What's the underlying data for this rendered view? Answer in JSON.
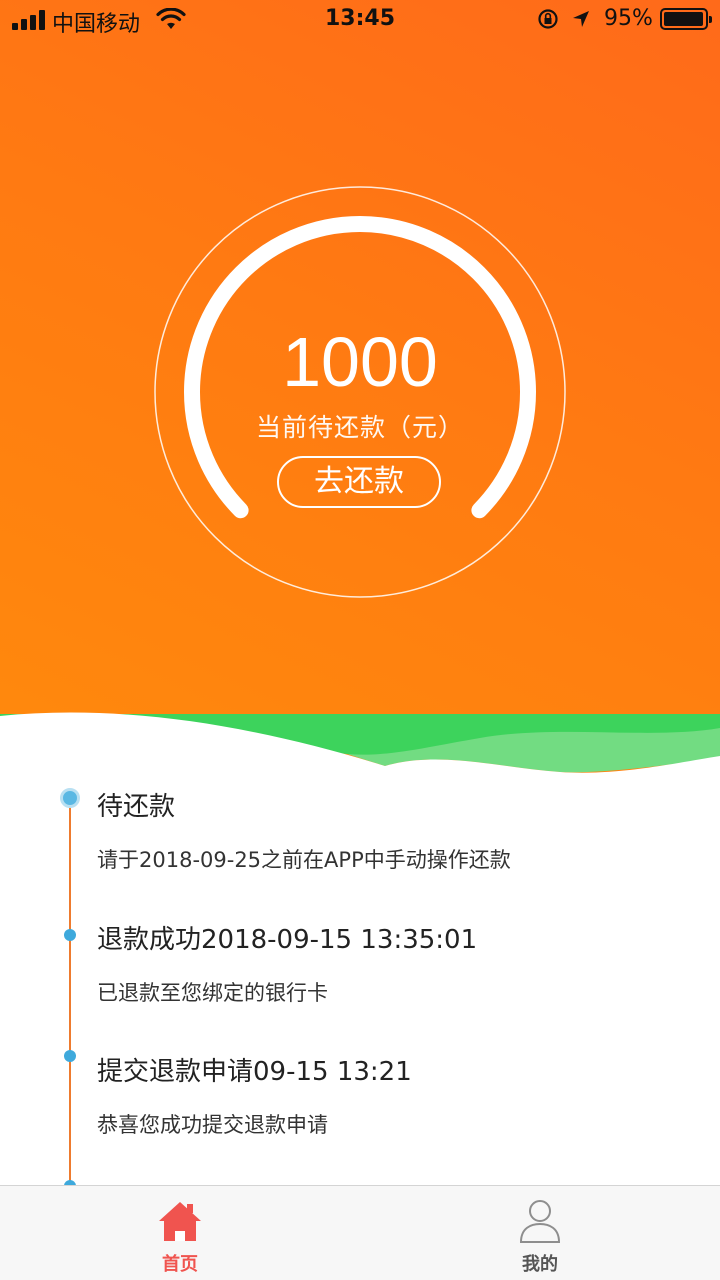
{
  "status_bar": {
    "carrier": "中国移动",
    "time": "13:45",
    "battery": "95%",
    "icons": [
      "signal-icon",
      "wifi-icon",
      "orientation-lock-icon",
      "location-icon",
      "battery-icon"
    ]
  },
  "hero": {
    "amount": "1000",
    "amount_label": "当前待还款（元）",
    "repay_button": "去还款",
    "gradient": [
      "#ff6a1a",
      "#ff8a0c"
    ]
  },
  "timeline": {
    "line_color": "#ee7b2e",
    "dot_color": "#3ea9dc",
    "items": [
      {
        "title": "待还款",
        "desc": "请于2018-09-25之前在APP中手动操作还款"
      },
      {
        "title": "退款成功2018-09-15 13:35:01",
        "desc": "已退款至您绑定的银行卡"
      },
      {
        "title": "提交退款申请09-15 13:21",
        "desc": "恭喜您成功提交退款申请"
      }
    ]
  },
  "tab_bar": {
    "active_color": "#f0544f",
    "tabs": [
      {
        "label": "首页",
        "icon": "home-icon",
        "active": true
      },
      {
        "label": "我的",
        "icon": "user-icon",
        "active": false
      }
    ]
  }
}
